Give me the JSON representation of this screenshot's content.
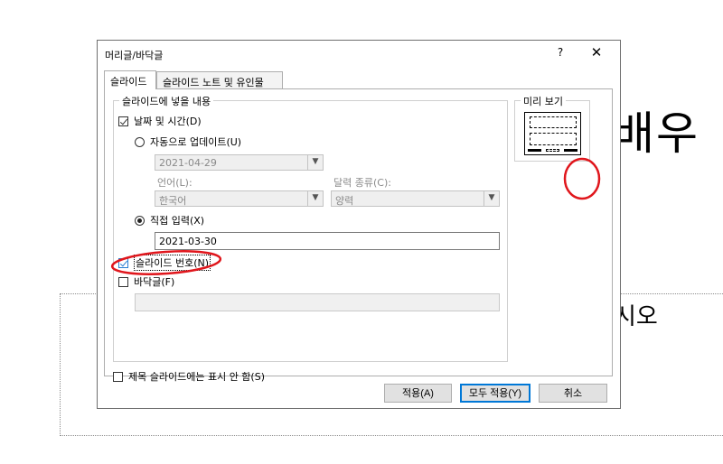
{
  "slide": {
    "title_fragment": "배우",
    "subtitle_fragment": "시오"
  },
  "dialog": {
    "title": "머리글/바닥글",
    "help": "?",
    "close": "✕",
    "tabs": [
      {
        "label": "슬라이드",
        "active": true
      },
      {
        "label": "슬라이드 노트 및 유인물",
        "active": false
      }
    ],
    "include_group_label": "슬라이드에 넣을 내용",
    "datetime": {
      "label": "날짜 및 시간(D)",
      "checked": true
    },
    "auto_update": {
      "label": "자동으로 업데이트(U)",
      "selected": false
    },
    "auto_date_value": "2021-04-29",
    "language_label": "언어(L):",
    "language_value": "한국어",
    "calendar_label": "달력 종류(C):",
    "calendar_value": "양력",
    "fixed": {
      "label": "직접 입력(X)",
      "selected": true
    },
    "fixed_value": "2021-03-30",
    "slide_number": {
      "label": "슬라이드 번호(N)",
      "checked": true
    },
    "footer": {
      "label": "바닥글(F)",
      "checked": false
    },
    "footer_value": "",
    "title_slide": {
      "label": "제목 슬라이드에는 표시 안 함(S)",
      "checked": false
    },
    "preview_label": "미리 보기",
    "buttons": {
      "apply": "적용(A)",
      "apply_all": "모두 적용(Y)",
      "cancel": "취소"
    }
  },
  "colors": {
    "annotation": "#e0161c",
    "focus_blue": "#0078d7"
  }
}
